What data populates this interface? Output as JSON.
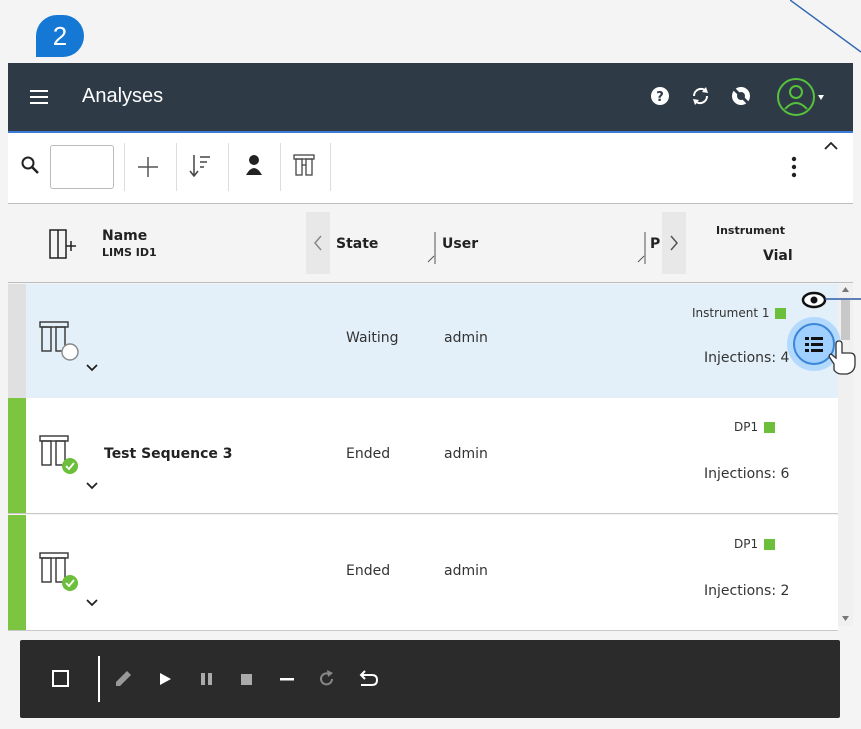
{
  "step_number": "2",
  "topbar": {
    "title": "Analyses"
  },
  "columns": {
    "name": "Name",
    "lims": "LIMS ID1",
    "state": "State",
    "user": "User",
    "p": "P",
    "instrument": "Instrument",
    "vial": "Vial"
  },
  "rows": [
    {
      "name": "",
      "state": "Waiting",
      "user": "admin",
      "instrument": "Instrument 1",
      "injections": "Injections: 4",
      "bar_color": "#e0e0e0",
      "selected": true
    },
    {
      "name": "Test Sequence 3",
      "state": "Ended",
      "user": "admin",
      "instrument": "DP1",
      "injections": "Injections: 6",
      "bar_color": "#7cc540",
      "selected": false
    },
    {
      "name": "",
      "state": "Ended",
      "user": "admin",
      "instrument": "DP1",
      "injections": "Injections: 2",
      "bar_color": "#7cc540",
      "selected": false
    }
  ],
  "colors": {
    "accent": "#1478d4",
    "topbar": "#2f3a47",
    "success": "#6cbf3a",
    "avatar": "#55c23b"
  }
}
